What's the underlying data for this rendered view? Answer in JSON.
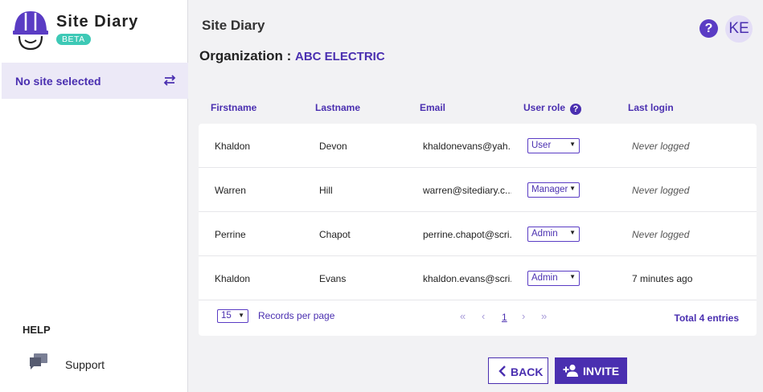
{
  "app": {
    "name": "Site Diary",
    "badge": "BETA"
  },
  "sidebar": {
    "site_selector_label": "No site selected",
    "help_heading": "HELP",
    "support_label": "Support"
  },
  "header": {
    "title": "Site Diary",
    "org_prefix": "Organization :",
    "org_name": "ABC ELECTRIC",
    "help_button": "?",
    "avatar_initials": "KE"
  },
  "table": {
    "columns": [
      "Firstname",
      "Lastname",
      "Email",
      "User role",
      "Last login"
    ],
    "rows": [
      {
        "firstname": "Khaldon",
        "lastname": "Devon",
        "email": "khaldonevans@yah...",
        "role": "User",
        "last_login": "Never logged"
      },
      {
        "firstname": "Warren",
        "lastname": "Hill",
        "email": "warren@sitediary.c...",
        "role": "Manager",
        "last_login": "Never logged"
      },
      {
        "firstname": "Perrine",
        "lastname": "Chapot",
        "email": "perrine.chapot@scri...",
        "role": "Admin",
        "last_login": "Never logged"
      },
      {
        "firstname": "Khaldon",
        "lastname": "Evans",
        "email": "khaldon.evans@scri...",
        "role": "Admin",
        "last_login": "7 minutes ago"
      }
    ],
    "page_size": "15",
    "records_per_page_label": "Records per page",
    "pagination": {
      "first": "«",
      "prev": "‹",
      "current": "1",
      "next": "›",
      "last": "»"
    },
    "total_label": "Total 4 entries"
  },
  "actions": {
    "back_label": "BACK",
    "invite_label": "INVITE"
  },
  "colors": {
    "accent": "#4a2fb0",
    "badge": "#3ec9b6",
    "selected_bg": "#ece9f7"
  }
}
